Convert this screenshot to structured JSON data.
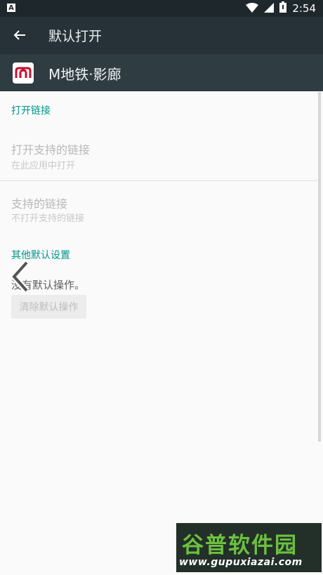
{
  "status_bar": {
    "badge": "A",
    "time": "2:54"
  },
  "toolbar": {
    "title": "默认打开"
  },
  "app": {
    "name": "M地铁·影廊"
  },
  "sections": {
    "open_links_header": "打开链接",
    "open_supported_links": {
      "title": "打开支持的链接",
      "summary": "在此应用中打开"
    },
    "supported_links": {
      "title": "支持的链接",
      "summary": "不打开支持的链接"
    },
    "other_defaults_header": "其他默认设置",
    "status_text": "没有默认操作。",
    "clear_button_label": "清除默认操作"
  },
  "watermark": {
    "brand": "谷普软件园",
    "url": "www.gupuxiazai.com"
  },
  "colors": {
    "accent": "#009688",
    "toolbar": "#263238",
    "appbar": "#2f3c42",
    "app_icon_red": "#c8102e"
  }
}
